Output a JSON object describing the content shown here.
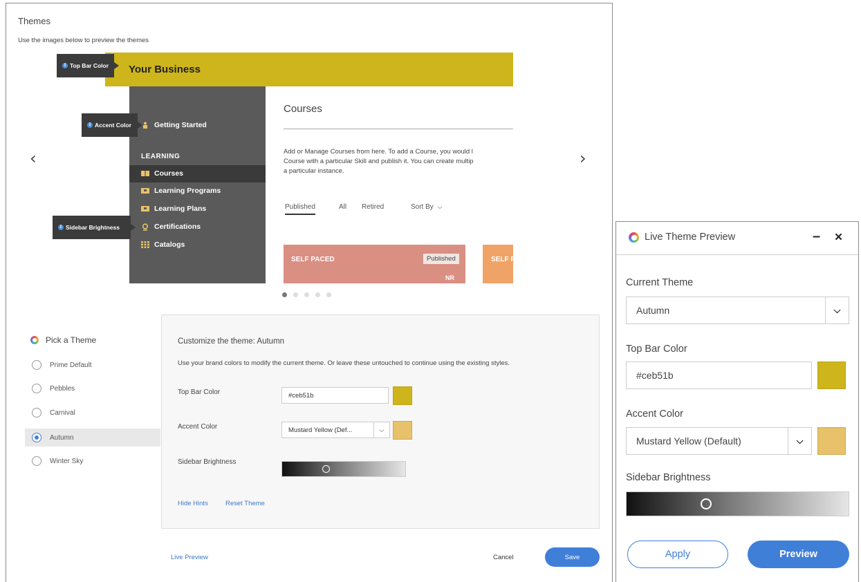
{
  "colors": {
    "top_bar": "#ceb51b",
    "accent": "#e8c26a",
    "link": "#3d79c9",
    "button": "#3f7fd8"
  },
  "themes": {
    "title": "Themes",
    "subtitle": "Use the images below to preview the themes",
    "prev_arrow": "‹",
    "next_arrow": "›"
  },
  "preview": {
    "business_name": "Your Business",
    "sidebar": {
      "getting_started": "Getting Started",
      "section": "LEARNING",
      "items": [
        "Courses",
        "Learning Programs",
        "Learning Plans",
        "Certifications",
        "Catalogs"
      ]
    },
    "main": {
      "title": "Courses",
      "desc_lines": [
        "Add or Manage Courses from here. To add a Course, you would l",
        "Course with a particular Skill and publish it. You can create multip",
        "a particular instance."
      ],
      "tabs": [
        "Published",
        "All",
        "Retired"
      ],
      "sort_by": "Sort By",
      "card1_label": "SELF PACED",
      "card1_badge": "Published",
      "card1_tag": "NR",
      "card2_label": "SELF F"
    },
    "hints": {
      "top_bar": "Top Bar Color",
      "accent": "Accent Color",
      "sidebar": "Sidebar Brightness"
    },
    "carousel": {
      "count": 5,
      "active": 0
    }
  },
  "pick_theme": {
    "title": "Pick a Theme",
    "options": [
      "Prime Default",
      "Pebbles",
      "Carnival",
      "Autumn",
      "Winter Sky"
    ],
    "selected": "Autumn"
  },
  "customize": {
    "title": "Customize the theme: Autumn",
    "desc": "Use your brand colors to modify the current theme. Or leave these untouched to continue using the existing styles.",
    "top_bar_label": "Top Bar Color",
    "top_bar_value": "#ceb51b",
    "accent_label": "Accent Color",
    "accent_value": "Mustard Yellow (Def...",
    "brightness_label": "Sidebar Brightness",
    "hide_hints": "Hide Hints",
    "reset_theme": "Reset Theme"
  },
  "footer": {
    "live_preview": "Live Preview",
    "cancel": "Cancel",
    "save": "Save"
  },
  "live_panel": {
    "title": "Live Theme Preview",
    "minimize": "–",
    "close": "×",
    "current_theme_label": "Current Theme",
    "current_theme_value": "Autumn",
    "top_bar_label": "Top Bar Color",
    "top_bar_value": "#ceb51b",
    "accent_label": "Accent Color",
    "accent_value": "Mustard Yellow (Default)",
    "brightness_label": "Sidebar Brightness",
    "apply": "Apply",
    "preview": "Preview"
  }
}
